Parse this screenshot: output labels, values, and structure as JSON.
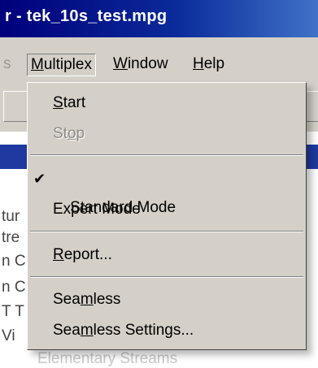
{
  "window": {
    "title": "r - tek_10s_test.mpg"
  },
  "menubar": {
    "faded_item": "s",
    "items": [
      {
        "label": "Multiplex",
        "mnemonic": "M",
        "rest": "ultiplex"
      },
      {
        "label": "Window",
        "mnemonic": "W",
        "rest": "indow"
      },
      {
        "label": "Help",
        "mnemonic": "H",
        "rest": "elp"
      }
    ]
  },
  "dropdown": {
    "start": {
      "pre": "",
      "mnemonic": "S",
      "post": "tart"
    },
    "stop": {
      "pre": "St",
      "mnemonic": "o",
      "post": "p"
    },
    "standard_mode": {
      "label": "Standard Mode",
      "check": "✔"
    },
    "expert_mode": {
      "label": "Expert Mode"
    },
    "report": {
      "pre": "",
      "mnemonic": "R",
      "post": "eport..."
    },
    "seamless": {
      "pre": "Sea",
      "mnemonic": "m",
      "post": "less"
    },
    "seamless_settings": {
      "pre": "Sea",
      "mnemonic": "m",
      "post": "less Settings..."
    }
  },
  "background": {
    "rows": [
      "tur",
      "tre",
      "n C",
      "n C",
      "T T",
      "Vi",
      "Elementary Streams"
    ]
  }
}
